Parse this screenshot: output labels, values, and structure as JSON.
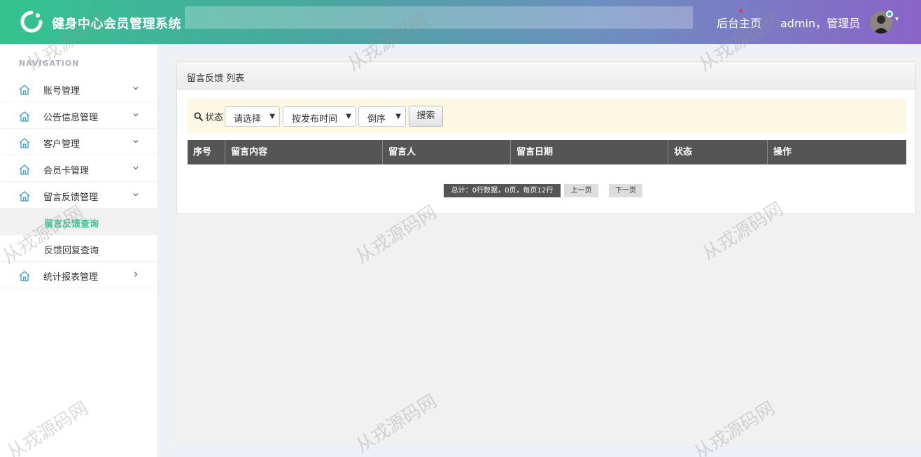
{
  "header": {
    "app_title": "健身中心会员管理系统",
    "home_link": "后台主页",
    "user_text": "admin，管理员"
  },
  "sidebar": {
    "nav_caption": "NAVIGATION",
    "items": [
      {
        "label": "账号管理",
        "caret": "down"
      },
      {
        "label": "公告信息管理",
        "caret": "down"
      },
      {
        "label": "客户管理",
        "caret": "down"
      },
      {
        "label": "会员卡管理",
        "caret": "down"
      },
      {
        "label": "留言反馈管理",
        "caret": "down",
        "expanded": true,
        "children": [
          {
            "label": "留言反馈查询",
            "active": true
          },
          {
            "label": "反馈回复查询",
            "active": false
          }
        ]
      },
      {
        "label": "统计报表管理",
        "caret": "right"
      }
    ]
  },
  "panel": {
    "title": "留言反馈 列表",
    "filter": {
      "label": "状态",
      "status_select": "请选择",
      "sort_field_select": "按发布时间",
      "order_select": "倒序",
      "search_button": "搜索"
    },
    "table": {
      "columns": [
        "序号",
        "留言内容",
        "留言人",
        "留言日期",
        "状态",
        "操作"
      ],
      "rows": []
    },
    "pager": {
      "summary": "总计：0行数据，0页，每页12行",
      "prev": "上一页",
      "next": "下一页"
    }
  },
  "watermark": "从戎源码网",
  "colors": {
    "accent_green": "#34c38f",
    "header_gradient_start": "#34c38f",
    "header_gradient_end": "#8a64c9",
    "table_header": "#555555",
    "filter_bar": "#fcf8e3"
  }
}
